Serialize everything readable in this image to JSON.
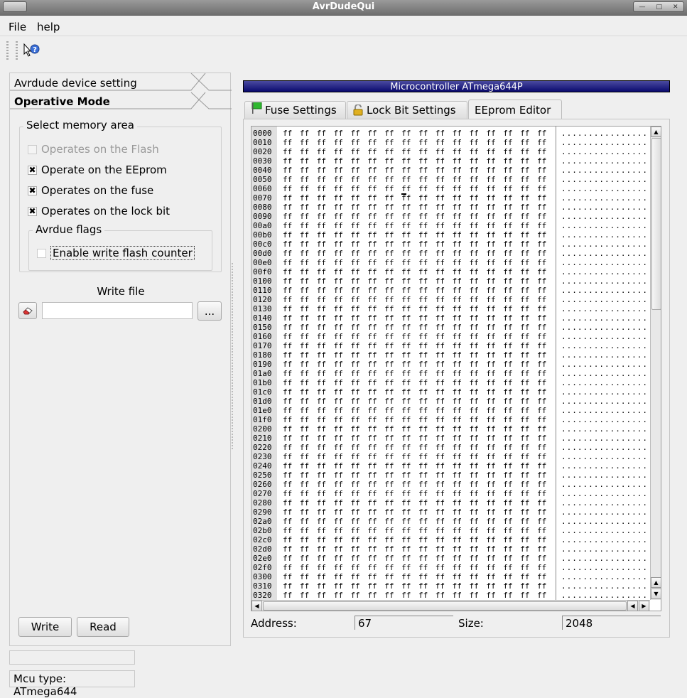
{
  "window": {
    "title": "AvrDudeQui"
  },
  "menu": {
    "file": "File",
    "help": "help"
  },
  "toolbar": {
    "help_icon": "whats-this-help-icon"
  },
  "left": {
    "toolbox_page1": "Avrdude device setting",
    "toolbox_page2": "Operative Mode",
    "memory_group_title": "Select memory area",
    "checks": [
      {
        "label": "Operates on the Flash",
        "checked": false,
        "enabled": false
      },
      {
        "label": "Operate on the EEprom",
        "checked": true,
        "enabled": true
      },
      {
        "label": "Operates on the fuse",
        "checked": true,
        "enabled": true
      },
      {
        "label": "Operates on the lock bit",
        "checked": true,
        "enabled": true
      }
    ],
    "flags_group_title": "Avrdue flags",
    "flag_check": {
      "label": "Enable write flash counter",
      "checked": false
    },
    "write_file_label": "Write file",
    "write_file_value": "",
    "browse_label": "...",
    "write_button": "Write",
    "read_button": "Read",
    "progress_text": "",
    "mcu_type": "Mcu type: ATmega644"
  },
  "right": {
    "mcu_banner": "Microcontroller ATmega644P",
    "tabs": [
      "Fuse Settings",
      "Lock Bit Settings",
      "EEprom Editor"
    ],
    "active_tab": "EEprom Editor",
    "hex": {
      "addresses": [
        "0000",
        "0010",
        "0020",
        "0030",
        "0040",
        "0050",
        "0060",
        "0070",
        "0080",
        "0090",
        "00a0",
        "00b0",
        "00c0",
        "00d0",
        "00e0",
        "00f0",
        "0100",
        "0110",
        "0120",
        "0130",
        "0140",
        "0150",
        "0160",
        "0170",
        "0180",
        "0190",
        "01a0",
        "01b0",
        "01c0",
        "01d0",
        "01e0",
        "01f0",
        "0200",
        "0210",
        "0220",
        "0230",
        "0240",
        "0250",
        "0260",
        "0270",
        "0280",
        "0290",
        "02a0",
        "02b0",
        "02c0",
        "02d0",
        "02e0",
        "02f0",
        "0300",
        "0310",
        "0320"
      ],
      "row_bytes": "ff ff ff ff ff ff ff ff ff ff ff ff ff ff ff ff",
      "row_ascii": "................"
    },
    "address_label": "Address:",
    "address_value": "67",
    "size_label": "Size:",
    "size_value": "2048"
  }
}
